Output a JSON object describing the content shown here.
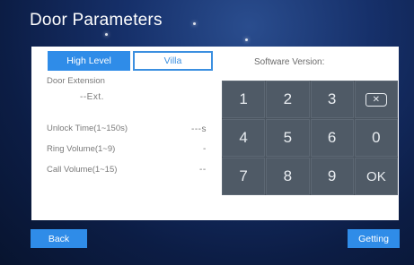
{
  "window": {
    "title": "Door Parameters"
  },
  "tabs": [
    {
      "label": "High Level",
      "selected": true
    },
    {
      "label": "Villa",
      "selected": false
    }
  ],
  "software_version_label": "Software Version:",
  "fields": {
    "door_extension": {
      "label": "Door Extension",
      "value": "--Ext."
    },
    "unlock_time": {
      "label": "Unlock Time(1~150s)",
      "value": "---s"
    },
    "ring_volume": {
      "label": "Ring Volume(1~9)",
      "value": "-"
    },
    "call_volume": {
      "label": "Call Volume(1~15)",
      "value": "--"
    }
  },
  "keypad": {
    "keys": [
      "1",
      "2",
      "3",
      "4",
      "5",
      "6",
      "0",
      "7",
      "8",
      "9",
      "OK"
    ],
    "backspace_icon": "backspace-icon"
  },
  "footer": {
    "back_label": "Back",
    "getting_label": "Getting"
  },
  "colors": {
    "accent": "#2f8ce8",
    "keypad": "#4f5a66",
    "background": "#0c1d45"
  }
}
